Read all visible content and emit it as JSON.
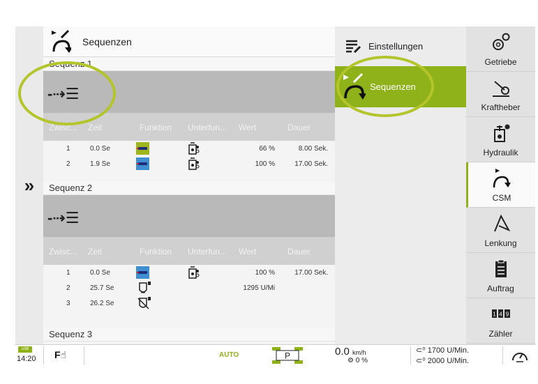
{
  "colors": {
    "accent_green": "#8fb21a",
    "function_green": "#9fb51c",
    "function_blue": "#3e8ed0",
    "highlight_ring": "#b3c52a"
  },
  "left_strip": {
    "icon": "double-chevron-right-icon",
    "glyph": "»"
  },
  "header": {
    "title": "Sequenzen",
    "icon": "csm-sequence-icon"
  },
  "columns": [
    "Zwisc...",
    "Zeit",
    "Funktion",
    "Unterfun...",
    "Wert",
    "Dauer"
  ],
  "sequences": [
    {
      "label": "Sequenz 1",
      "rows": [
        {
          "nr": "1",
          "zeit": "0.0 Se",
          "funktion": "hydraulic-valve-green",
          "unterfunktion": "valve-sub-icon",
          "wert": "66 %",
          "dauer": "8.00 Sek."
        },
        {
          "nr": "2",
          "zeit": "1.9 Se",
          "funktion": "hydraulic-valve-blue",
          "unterfunktion": "valve-sub-icon",
          "wert": "100 %",
          "dauer": "17.00 Sek."
        }
      ]
    },
    {
      "label": "Sequenz 2",
      "rows": [
        {
          "nr": "1",
          "zeit": "0.0 Se",
          "funktion": "hydraulic-valve-blue",
          "unterfunktion": "valve-sub-icon",
          "wert": "100 %",
          "dauer": "17.00 Sek."
        },
        {
          "nr": "2",
          "zeit": "25.7 Se",
          "funktion": "engine-speed-icon",
          "unterfunktion": "",
          "wert": "1295 U/Mi",
          "dauer": ""
        },
        {
          "nr": "3",
          "zeit": "26.2 Se",
          "funktion": "engine-speed-off-icon",
          "unterfunktion": "",
          "wert": "",
          "dauer": ""
        }
      ]
    },
    {
      "label": "Sequenz 3"
    }
  ],
  "middle": {
    "settings_label": "Einstellungen",
    "sequences_label": "Sequenzen"
  },
  "nav": [
    {
      "label": "Getriebe",
      "icon": "gears-icon"
    },
    {
      "label": "Kraftheber",
      "icon": "hitch-icon"
    },
    {
      "label": "Hydraulik",
      "icon": "hydraulic-icon"
    },
    {
      "label": "CSM",
      "icon": "csm-icon",
      "active": true
    },
    {
      "label": "Lenkung",
      "icon": "steering-icon"
    },
    {
      "label": "Auftrag",
      "icon": "clipboard-icon"
    },
    {
      "label": "Zähler",
      "icon": "counter-icon"
    }
  ],
  "status": {
    "usb_badge": "USB",
    "time": "14:20",
    "fb_label": "F",
    "auto_label": "AUTO",
    "park_label": "P",
    "speed_value": "0.0",
    "speed_unit": "km/h",
    "slip_value": "0 %",
    "rpm_set_1": "1700 U/Min.",
    "rpm_set_2": "2000 U/Min."
  }
}
